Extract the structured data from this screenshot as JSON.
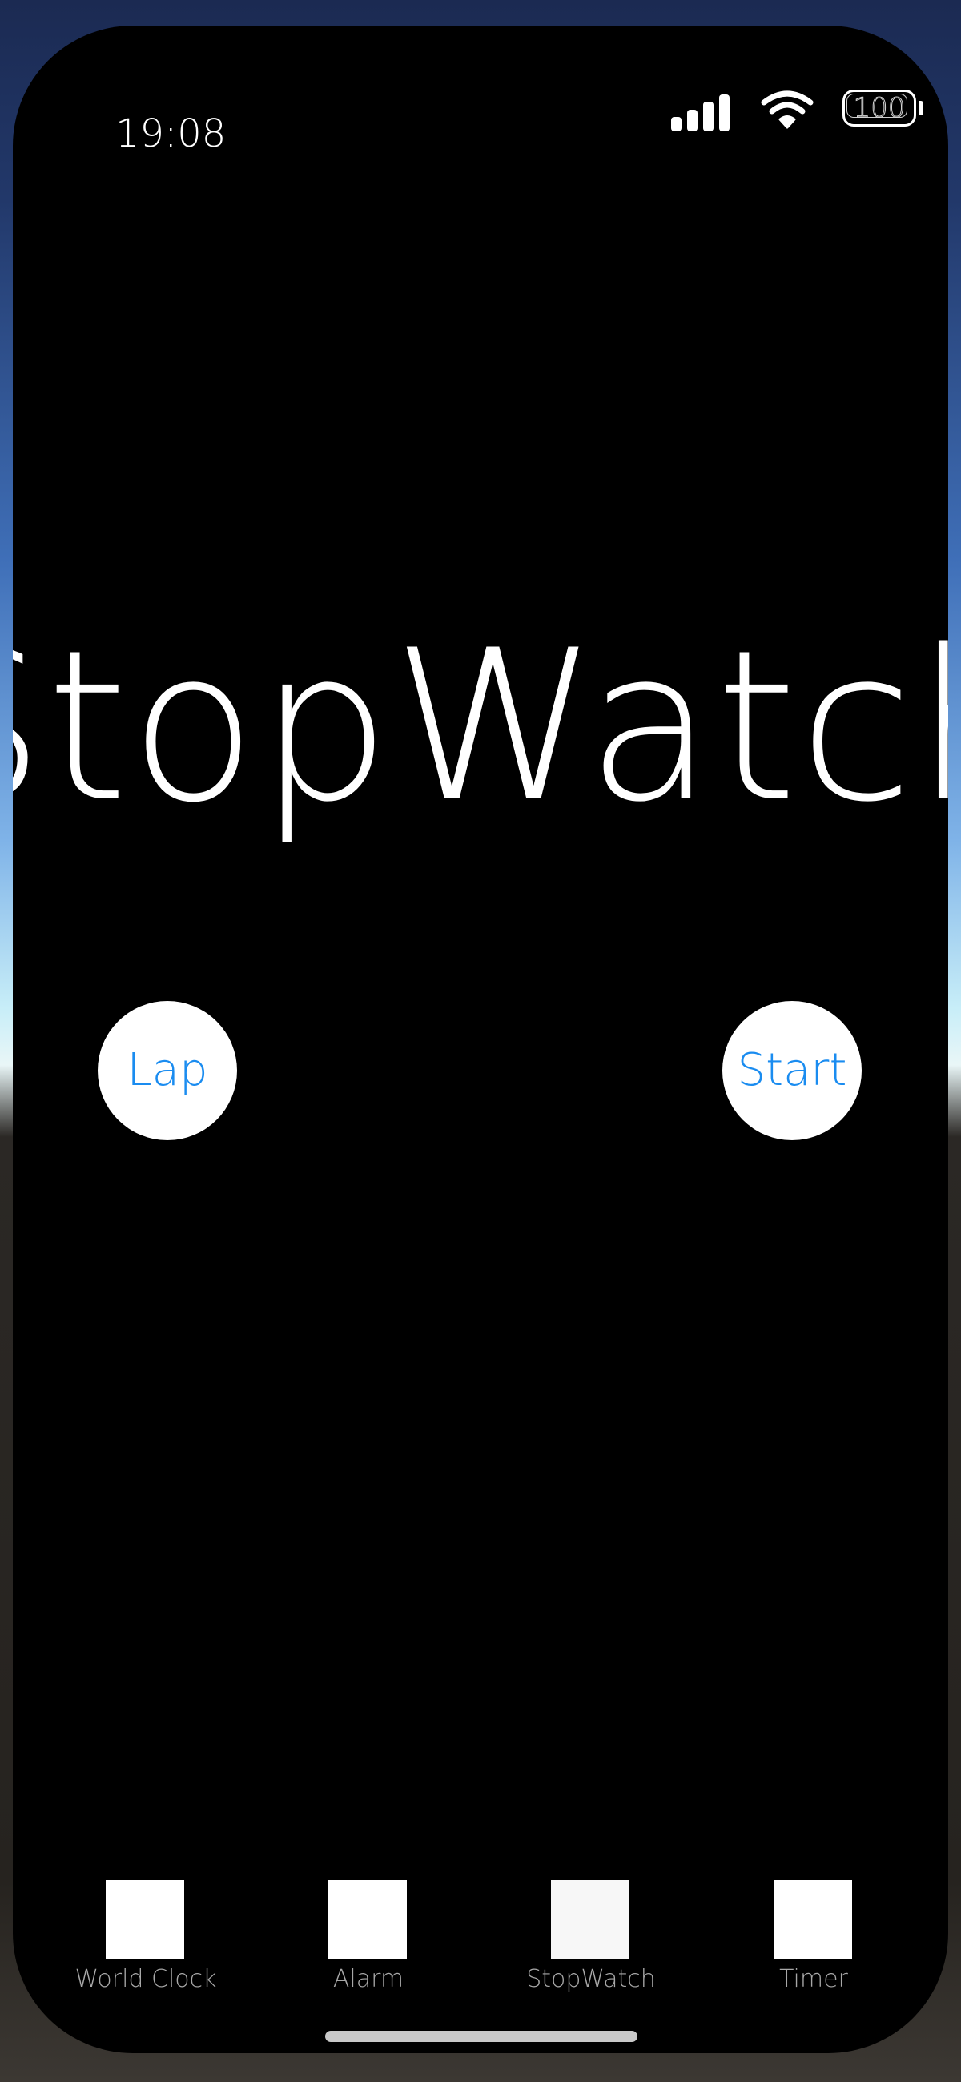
{
  "status_bar": {
    "time": "19:08",
    "battery": "100"
  },
  "main": {
    "title": "StopWatch"
  },
  "buttons": {
    "lap": "Lap",
    "start": "Start"
  },
  "tabs": [
    {
      "label": "World Clock"
    },
    {
      "label": "Alarm"
    },
    {
      "label": "StopWatch"
    },
    {
      "label": "Timer"
    }
  ],
  "colors": {
    "accent": "#1a8cf0",
    "background": "#000000",
    "tab_label": "#a8a8a8"
  }
}
